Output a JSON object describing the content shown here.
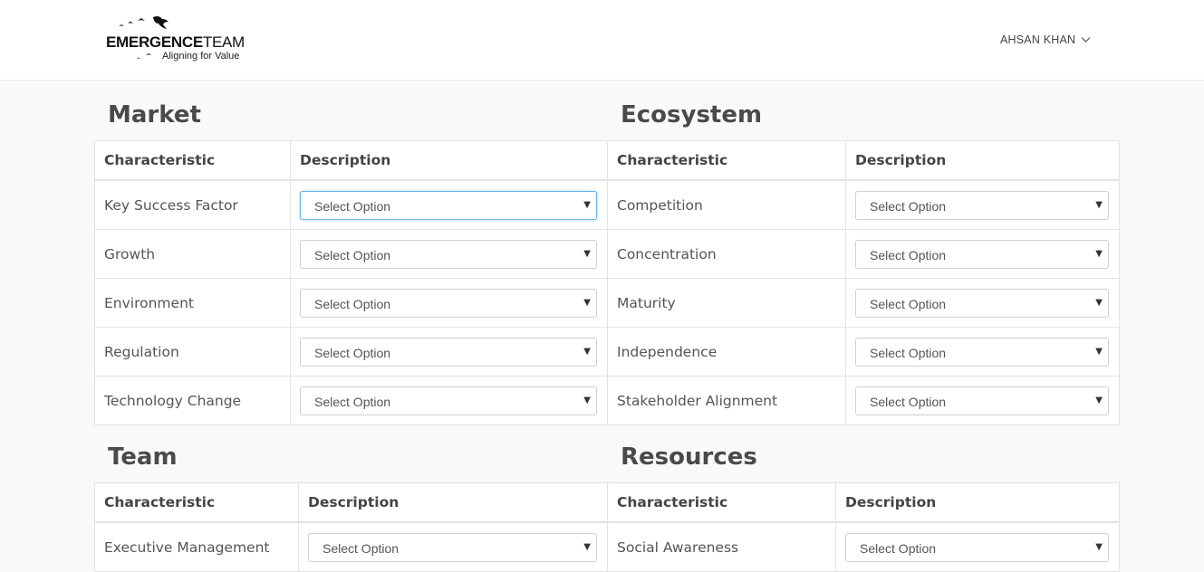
{
  "header": {
    "logo": {
      "brand_bold": "EMERGENCE",
      "brand_light": "TEAM",
      "tagline": "Aligning for Value"
    },
    "user_name": "AHSAN KHAN",
    "user_menu_icon": "chevron-down-icon"
  },
  "sections": {
    "market": {
      "title": "Market",
      "col_characteristic": "Characteristic",
      "col_description": "Description",
      "rows": [
        {
          "label": "Key Success Factor",
          "select": "Select Option"
        },
        {
          "label": "Growth",
          "select": "Select Option"
        },
        {
          "label": "Environment",
          "select": "Select Option"
        },
        {
          "label": "Regulation",
          "select": "Select Option"
        },
        {
          "label": "Technology Change",
          "select": "Select Option"
        }
      ]
    },
    "ecosystem": {
      "title": "Ecosystem",
      "col_characteristic": "Characteristic",
      "col_description": "Description",
      "rows": [
        {
          "label": "Competition",
          "select": "Select Option"
        },
        {
          "label": "Concentration",
          "select": "Select Option"
        },
        {
          "label": "Maturity",
          "select": "Select Option"
        },
        {
          "label": "Independence",
          "select": "Select Option"
        },
        {
          "label": "Stakeholder Alignment",
          "select": "Select Option"
        }
      ]
    },
    "team": {
      "title": "Team",
      "col_characteristic": "Characteristic",
      "col_description": "Description",
      "rows": [
        {
          "label": "Executive Management",
          "select": "Select Option"
        }
      ]
    },
    "resources": {
      "title": "Resources",
      "col_characteristic": "Characteristic",
      "col_description": "Description",
      "rows": [
        {
          "label": "Social Awareness",
          "select": "Select Option"
        }
      ]
    }
  },
  "colors": {
    "focus_border": "#66afe9",
    "heading": "#4a4a4a",
    "background": "#f9f9f9"
  }
}
